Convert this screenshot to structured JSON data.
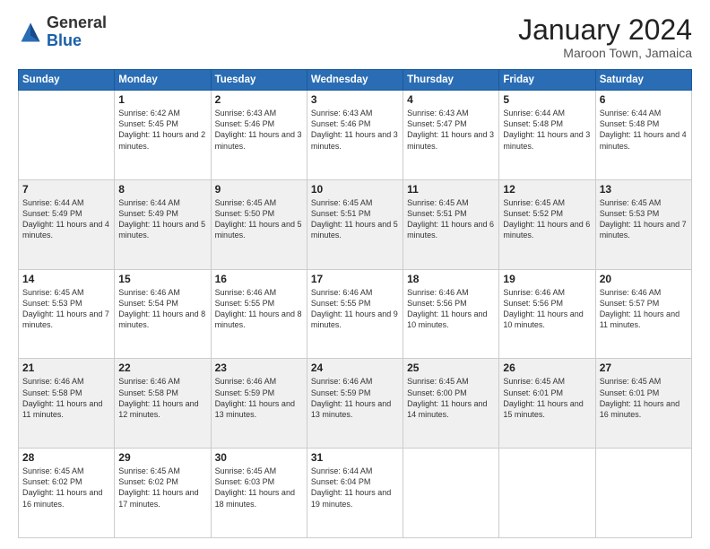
{
  "header": {
    "logo_general": "General",
    "logo_blue": "Blue",
    "month_title": "January 2024",
    "subtitle": "Maroon Town, Jamaica"
  },
  "days_of_week": [
    "Sunday",
    "Monday",
    "Tuesday",
    "Wednesday",
    "Thursday",
    "Friday",
    "Saturday"
  ],
  "weeks": [
    [
      {
        "day": "",
        "sunrise": "",
        "sunset": "",
        "daylight": ""
      },
      {
        "day": "1",
        "sunrise": "Sunrise: 6:42 AM",
        "sunset": "Sunset: 5:45 PM",
        "daylight": "Daylight: 11 hours and 2 minutes."
      },
      {
        "day": "2",
        "sunrise": "Sunrise: 6:43 AM",
        "sunset": "Sunset: 5:46 PM",
        "daylight": "Daylight: 11 hours and 3 minutes."
      },
      {
        "day": "3",
        "sunrise": "Sunrise: 6:43 AM",
        "sunset": "Sunset: 5:46 PM",
        "daylight": "Daylight: 11 hours and 3 minutes."
      },
      {
        "day": "4",
        "sunrise": "Sunrise: 6:43 AM",
        "sunset": "Sunset: 5:47 PM",
        "daylight": "Daylight: 11 hours and 3 minutes."
      },
      {
        "day": "5",
        "sunrise": "Sunrise: 6:44 AM",
        "sunset": "Sunset: 5:48 PM",
        "daylight": "Daylight: 11 hours and 3 minutes."
      },
      {
        "day": "6",
        "sunrise": "Sunrise: 6:44 AM",
        "sunset": "Sunset: 5:48 PM",
        "daylight": "Daylight: 11 hours and 4 minutes."
      }
    ],
    [
      {
        "day": "7",
        "sunrise": "Sunrise: 6:44 AM",
        "sunset": "Sunset: 5:49 PM",
        "daylight": "Daylight: 11 hours and 4 minutes."
      },
      {
        "day": "8",
        "sunrise": "Sunrise: 6:44 AM",
        "sunset": "Sunset: 5:49 PM",
        "daylight": "Daylight: 11 hours and 5 minutes."
      },
      {
        "day": "9",
        "sunrise": "Sunrise: 6:45 AM",
        "sunset": "Sunset: 5:50 PM",
        "daylight": "Daylight: 11 hours and 5 minutes."
      },
      {
        "day": "10",
        "sunrise": "Sunrise: 6:45 AM",
        "sunset": "Sunset: 5:51 PM",
        "daylight": "Daylight: 11 hours and 5 minutes."
      },
      {
        "day": "11",
        "sunrise": "Sunrise: 6:45 AM",
        "sunset": "Sunset: 5:51 PM",
        "daylight": "Daylight: 11 hours and 6 minutes."
      },
      {
        "day": "12",
        "sunrise": "Sunrise: 6:45 AM",
        "sunset": "Sunset: 5:52 PM",
        "daylight": "Daylight: 11 hours and 6 minutes."
      },
      {
        "day": "13",
        "sunrise": "Sunrise: 6:45 AM",
        "sunset": "Sunset: 5:53 PM",
        "daylight": "Daylight: 11 hours and 7 minutes."
      }
    ],
    [
      {
        "day": "14",
        "sunrise": "Sunrise: 6:45 AM",
        "sunset": "Sunset: 5:53 PM",
        "daylight": "Daylight: 11 hours and 7 minutes."
      },
      {
        "day": "15",
        "sunrise": "Sunrise: 6:46 AM",
        "sunset": "Sunset: 5:54 PM",
        "daylight": "Daylight: 11 hours and 8 minutes."
      },
      {
        "day": "16",
        "sunrise": "Sunrise: 6:46 AM",
        "sunset": "Sunset: 5:55 PM",
        "daylight": "Daylight: 11 hours and 8 minutes."
      },
      {
        "day": "17",
        "sunrise": "Sunrise: 6:46 AM",
        "sunset": "Sunset: 5:55 PM",
        "daylight": "Daylight: 11 hours and 9 minutes."
      },
      {
        "day": "18",
        "sunrise": "Sunrise: 6:46 AM",
        "sunset": "Sunset: 5:56 PM",
        "daylight": "Daylight: 11 hours and 10 minutes."
      },
      {
        "day": "19",
        "sunrise": "Sunrise: 6:46 AM",
        "sunset": "Sunset: 5:56 PM",
        "daylight": "Daylight: 11 hours and 10 minutes."
      },
      {
        "day": "20",
        "sunrise": "Sunrise: 6:46 AM",
        "sunset": "Sunset: 5:57 PM",
        "daylight": "Daylight: 11 hours and 11 minutes."
      }
    ],
    [
      {
        "day": "21",
        "sunrise": "Sunrise: 6:46 AM",
        "sunset": "Sunset: 5:58 PM",
        "daylight": "Daylight: 11 hours and 11 minutes."
      },
      {
        "day": "22",
        "sunrise": "Sunrise: 6:46 AM",
        "sunset": "Sunset: 5:58 PM",
        "daylight": "Daylight: 11 hours and 12 minutes."
      },
      {
        "day": "23",
        "sunrise": "Sunrise: 6:46 AM",
        "sunset": "Sunset: 5:59 PM",
        "daylight": "Daylight: 11 hours and 13 minutes."
      },
      {
        "day": "24",
        "sunrise": "Sunrise: 6:46 AM",
        "sunset": "Sunset: 5:59 PM",
        "daylight": "Daylight: 11 hours and 13 minutes."
      },
      {
        "day": "25",
        "sunrise": "Sunrise: 6:45 AM",
        "sunset": "Sunset: 6:00 PM",
        "daylight": "Daylight: 11 hours and 14 minutes."
      },
      {
        "day": "26",
        "sunrise": "Sunrise: 6:45 AM",
        "sunset": "Sunset: 6:01 PM",
        "daylight": "Daylight: 11 hours and 15 minutes."
      },
      {
        "day": "27",
        "sunrise": "Sunrise: 6:45 AM",
        "sunset": "Sunset: 6:01 PM",
        "daylight": "Daylight: 11 hours and 16 minutes."
      }
    ],
    [
      {
        "day": "28",
        "sunrise": "Sunrise: 6:45 AM",
        "sunset": "Sunset: 6:02 PM",
        "daylight": "Daylight: 11 hours and 16 minutes."
      },
      {
        "day": "29",
        "sunrise": "Sunrise: 6:45 AM",
        "sunset": "Sunset: 6:02 PM",
        "daylight": "Daylight: 11 hours and 17 minutes."
      },
      {
        "day": "30",
        "sunrise": "Sunrise: 6:45 AM",
        "sunset": "Sunset: 6:03 PM",
        "daylight": "Daylight: 11 hours and 18 minutes."
      },
      {
        "day": "31",
        "sunrise": "Sunrise: 6:44 AM",
        "sunset": "Sunset: 6:04 PM",
        "daylight": "Daylight: 11 hours and 19 minutes."
      },
      {
        "day": "",
        "sunrise": "",
        "sunset": "",
        "daylight": ""
      },
      {
        "day": "",
        "sunrise": "",
        "sunset": "",
        "daylight": ""
      },
      {
        "day": "",
        "sunrise": "",
        "sunset": "",
        "daylight": ""
      }
    ]
  ]
}
